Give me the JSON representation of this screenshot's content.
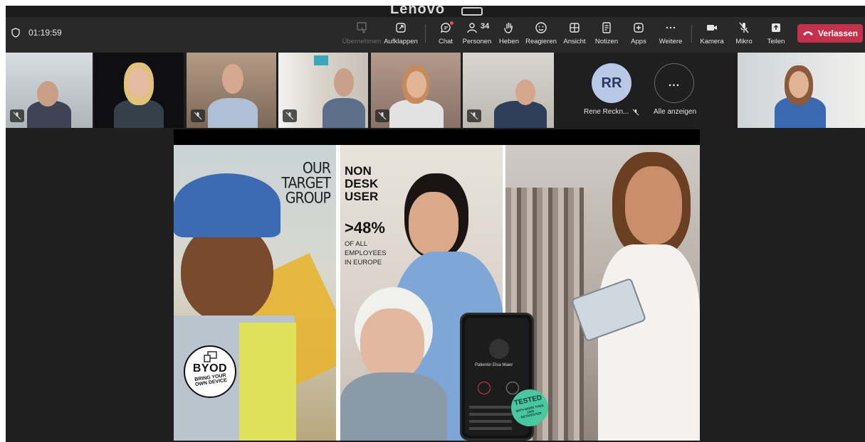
{
  "top_window": {
    "title": "Lenovo"
  },
  "toolbar": {
    "timer": "01:19:59",
    "buttons": {
      "take_control": "Übernehmen",
      "popout": "Aufklappen",
      "chat": "Chat",
      "people": "Personen",
      "people_count": "34",
      "raise": "Heben",
      "react": "Reagieren",
      "view": "Ansicht",
      "notes": "Notizen",
      "apps": "Apps",
      "more": "Weitere",
      "camera": "Kamera",
      "mic": "Mikro",
      "share": "Teilen"
    },
    "leave": "Verlassen",
    "colors": {
      "leave": "#c4314b",
      "notification": "#e5553a",
      "speaking_outline": "#7f85f5"
    }
  },
  "participants": {
    "rr": {
      "initials": "RR",
      "name": "Rene Reckn..."
    },
    "more": {
      "glyph": "...",
      "label": "Alle anzeigen"
    }
  },
  "slide": {
    "our_target": [
      "OUR",
      "TARGET",
      "GROUP"
    ],
    "non_desk": [
      "NON",
      "DESK",
      "USER"
    ],
    "percent": ">48%",
    "percent_sub": [
      "OF ALL",
      "EMPLOYEES",
      "IN EUROPE"
    ],
    "byod": {
      "big": "BYOD",
      "small": "BRING YOUR OWN DEVICE"
    },
    "phone": {
      "patient": "Patientin Elsa Maier"
    },
    "tested": {
      "big": "TESTED",
      "small": "WITH MORE THEN 1000 BETATESTER"
    }
  }
}
